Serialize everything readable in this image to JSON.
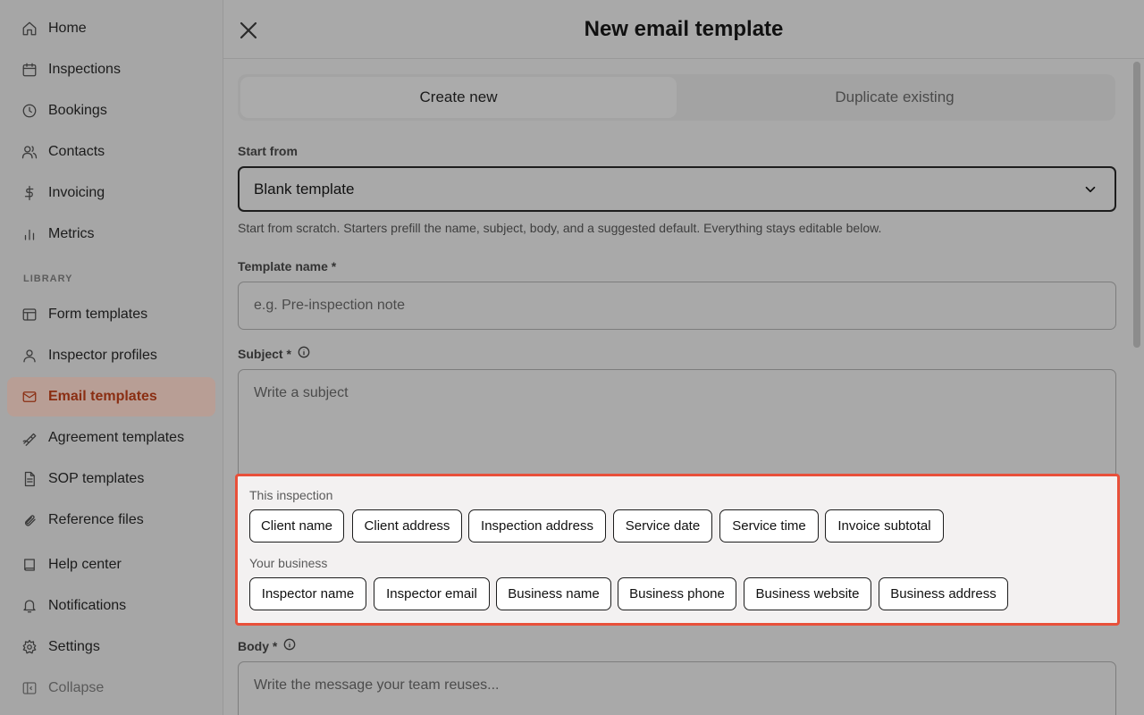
{
  "sidebar": {
    "items": [
      {
        "label": "Home",
        "icon": "home-icon"
      },
      {
        "label": "Inspections",
        "icon": "calendar-icon"
      },
      {
        "label": "Bookings",
        "icon": "clock-icon"
      },
      {
        "label": "Contacts",
        "icon": "users-icon"
      },
      {
        "label": "Invoicing",
        "icon": "dollar-icon"
      },
      {
        "label": "Metrics",
        "icon": "bar-chart-icon"
      }
    ],
    "library_label": "LIBRARY",
    "library_items": [
      {
        "label": "Form templates",
        "icon": "layout-icon"
      },
      {
        "label": "Inspector profiles",
        "icon": "user-icon"
      },
      {
        "label": "Email templates",
        "icon": "mail-icon",
        "active": true
      },
      {
        "label": "Agreement templates",
        "icon": "signature-icon"
      },
      {
        "label": "SOP templates",
        "icon": "document-icon"
      },
      {
        "label": "Reference files",
        "icon": "paperclip-icon"
      }
    ],
    "footer_items": [
      {
        "label": "Help center",
        "icon": "book-icon"
      },
      {
        "label": "Notifications",
        "icon": "bell-icon"
      },
      {
        "label": "Settings",
        "icon": "gear-icon"
      },
      {
        "label": "Collapse",
        "icon": "sidebar-collapse-icon"
      }
    ]
  },
  "header": {
    "title": "New email template"
  },
  "tabs": [
    "Create new",
    "Duplicate existing"
  ],
  "form": {
    "start_from_label": "Start from",
    "start_from_value": "Blank template",
    "start_from_help": "Start from scratch. Starters prefill the name, subject, body, and a suggested default. Everything stays editable below.",
    "name_label": "Template name *",
    "name_placeholder": "e.g. Pre-inspection note",
    "subject_label": "Subject *",
    "subject_placeholder": "Write a subject",
    "body_label": "Body *",
    "body_placeholder": "Write the message your team reuses..."
  },
  "variables": {
    "groups": [
      {
        "label": "This inspection",
        "chips": [
          "Client name",
          "Client address",
          "Inspection address",
          "Service date",
          "Service time",
          "Invoice subtotal"
        ]
      },
      {
        "label": "Your business",
        "chips": [
          "Inspector name",
          "Inspector email",
          "Business name",
          "Business phone",
          "Business website",
          "Business address"
        ]
      }
    ]
  },
  "colors": {
    "accent": "#e8503a",
    "active_nav_bg": "#b89e95",
    "active_nav_text": "#8a2e12"
  }
}
